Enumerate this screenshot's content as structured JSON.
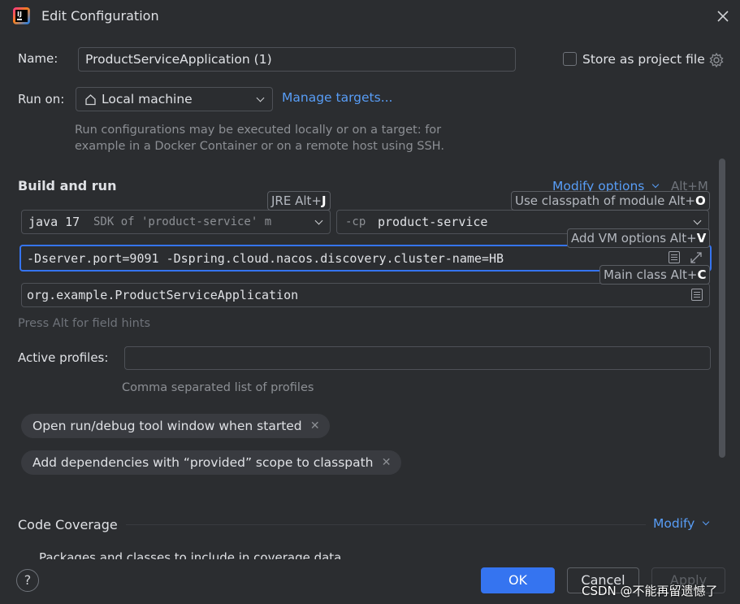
{
  "window": {
    "title": "Edit Configuration",
    "app_icon": "intellij-idea-icon",
    "close_icon": "close-icon"
  },
  "name": {
    "label": "Name:",
    "value": "ProductServiceApplication (1)"
  },
  "store_as_project_file": {
    "label": "Store as project file",
    "checked": false
  },
  "run_on": {
    "label": "Run on:",
    "selected": "Local machine",
    "manage_link": "Manage targets...",
    "description": "Run configurations may be executed locally or on a target: for example in a Docker Container or on a remote host using SSH."
  },
  "build_and_run": {
    "title": "Build and run",
    "modify_options": "Modify options",
    "modify_shortcut": "Alt+M",
    "jre_keyword": "java 17",
    "jre_detail": "SDK of 'product-service' m",
    "cp_prefix": "-cp",
    "cp_module": "product-service",
    "vm_options": "-Dserver.port=9091 -Dspring.cloud.nacos.discovery.cluster-name=HB",
    "main_class": "org.example.ProductServiceApplication",
    "field_hint": "Press Alt for field hints"
  },
  "hints": {
    "jre": {
      "text": "JRE Alt+",
      "key": "J"
    },
    "classpath": {
      "text": "Use classpath of module Alt+",
      "key": "O"
    },
    "vm": {
      "text": "Add VM options Alt+",
      "key": "V"
    },
    "main_class": {
      "text": "Main class Alt+",
      "key": "C"
    }
  },
  "active_profiles": {
    "label": "Active profiles:",
    "value": "",
    "description": "Comma separated list of profiles"
  },
  "chips": [
    {
      "label": "Open run/debug tool window when started"
    },
    {
      "label": "Add dependencies with “provided” scope to classpath"
    }
  ],
  "code_coverage": {
    "title": "Code Coverage",
    "modify": "Modify",
    "partial_text": "Packages and classes to include in coverage data"
  },
  "footer": {
    "help": "?",
    "ok": "OK",
    "cancel": "Cancel",
    "apply": "Apply"
  },
  "watermark": "CSDN @不能再留遗憾了",
  "colors": {
    "background": "#2b2d30",
    "accent": "#3574f0",
    "link": "#589df6"
  }
}
